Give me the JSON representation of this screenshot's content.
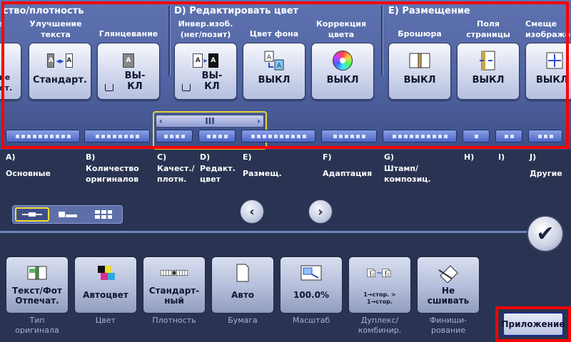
{
  "groups": [
    {
      "id": "c",
      "title": "ство/плотность"
    },
    {
      "id": "d",
      "title": "D)   Редактировать цвет"
    },
    {
      "id": "e",
      "title": "E)   Размещение"
    }
  ],
  "functions": {
    "partial_left": {
      "label": "ме",
      "value": "ие\nот."
    },
    "text_enhance": {
      "label": "Улучшение\nтекста",
      "value": "Стандарт."
    },
    "glossy": {
      "label": "Глянцевание",
      "value": "ВЫ-\nКЛ"
    },
    "invert": {
      "label": "Инвер.изоб.\n(нег/позит)",
      "value": "ВЫ-\nКЛ"
    },
    "bg_color": {
      "label": "Цвет фона",
      "value": "ВЫКЛ"
    },
    "color_correct": {
      "label": "Коррекция\nцвета",
      "value": "ВЫКЛ"
    },
    "booklet": {
      "label": "Брошюра",
      "value": "ВЫКЛ"
    },
    "margins": {
      "label": "Поля\nстраницы",
      "value": "ВЫКЛ"
    },
    "shift": {
      "label": "Смеще\nизображе",
      "value": "ВЫКЛ"
    }
  },
  "scrollbar": {
    "left": "‹",
    "grip": "III",
    "right": "›"
  },
  "sections": [
    {
      "letter": "A)",
      "name": "Основные"
    },
    {
      "letter": "B)",
      "name": "Количество\nоригиналов"
    },
    {
      "letter": "C)",
      "name": "Качест./\nплотн."
    },
    {
      "letter": "D)",
      "name": "Редакт.\nцвет"
    },
    {
      "letter": "E)",
      "name": "Размещ."
    },
    {
      "letter": "F)",
      "name": "Адаптация"
    },
    {
      "letter": "G)",
      "name": "Штамп/\nкомпозиц."
    },
    {
      "letter": "H)",
      "name": ""
    },
    {
      "letter": "I)",
      "name": ""
    },
    {
      "letter": "J)",
      "name": "Другие"
    }
  ],
  "nav": {
    "prev": "‹",
    "next": "›",
    "ok": "✔"
  },
  "quick": [
    {
      "value": "Текст/Фот\nОтпечат.",
      "caption": "Тип\nоригинала"
    },
    {
      "value": "Автоцвет",
      "caption": "Цвет"
    },
    {
      "value": "Стандарт-\nный",
      "caption": "Плотность"
    },
    {
      "value": "Авто",
      "caption": "Бумага"
    },
    {
      "value": "100.0%",
      "caption": "Масштаб"
    },
    {
      "value": "1→стор. >\n1→стор.",
      "caption": "Дуплекс/\nкомбинир."
    },
    {
      "value": "Не\nсшивать",
      "caption": "Финиши-\nрование"
    }
  ],
  "app_button": "Приложение",
  "colors": {
    "panel": "#5064a3",
    "frame": "#ff0000",
    "selection": "#e6d23a"
  }
}
